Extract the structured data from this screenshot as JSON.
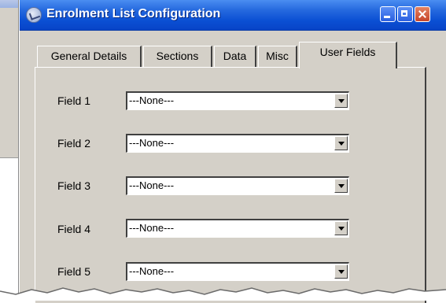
{
  "window": {
    "title": "Enrolment List Configuration"
  },
  "tabs": [
    {
      "label": "General Details"
    },
    {
      "label": "Sections"
    },
    {
      "label": "Data"
    },
    {
      "label": "Misc"
    },
    {
      "label": "User Fields",
      "active": true
    }
  ],
  "fields": [
    {
      "label": "Field 1",
      "value": "---None---"
    },
    {
      "label": "Field 2",
      "value": "---None---"
    },
    {
      "label": "Field 3",
      "value": "---None---"
    },
    {
      "label": "Field 4",
      "value": "---None---"
    },
    {
      "label": "Field 5",
      "value": "---None---"
    }
  ],
  "colors": {
    "titlebar": "#0a4fd3",
    "face": "#d4d0c8",
    "close": "#c7452a"
  },
  "icons": [
    "app-icon",
    "minimize-icon",
    "maximize-icon",
    "close-icon",
    "dropdown-arrow-icon"
  ]
}
